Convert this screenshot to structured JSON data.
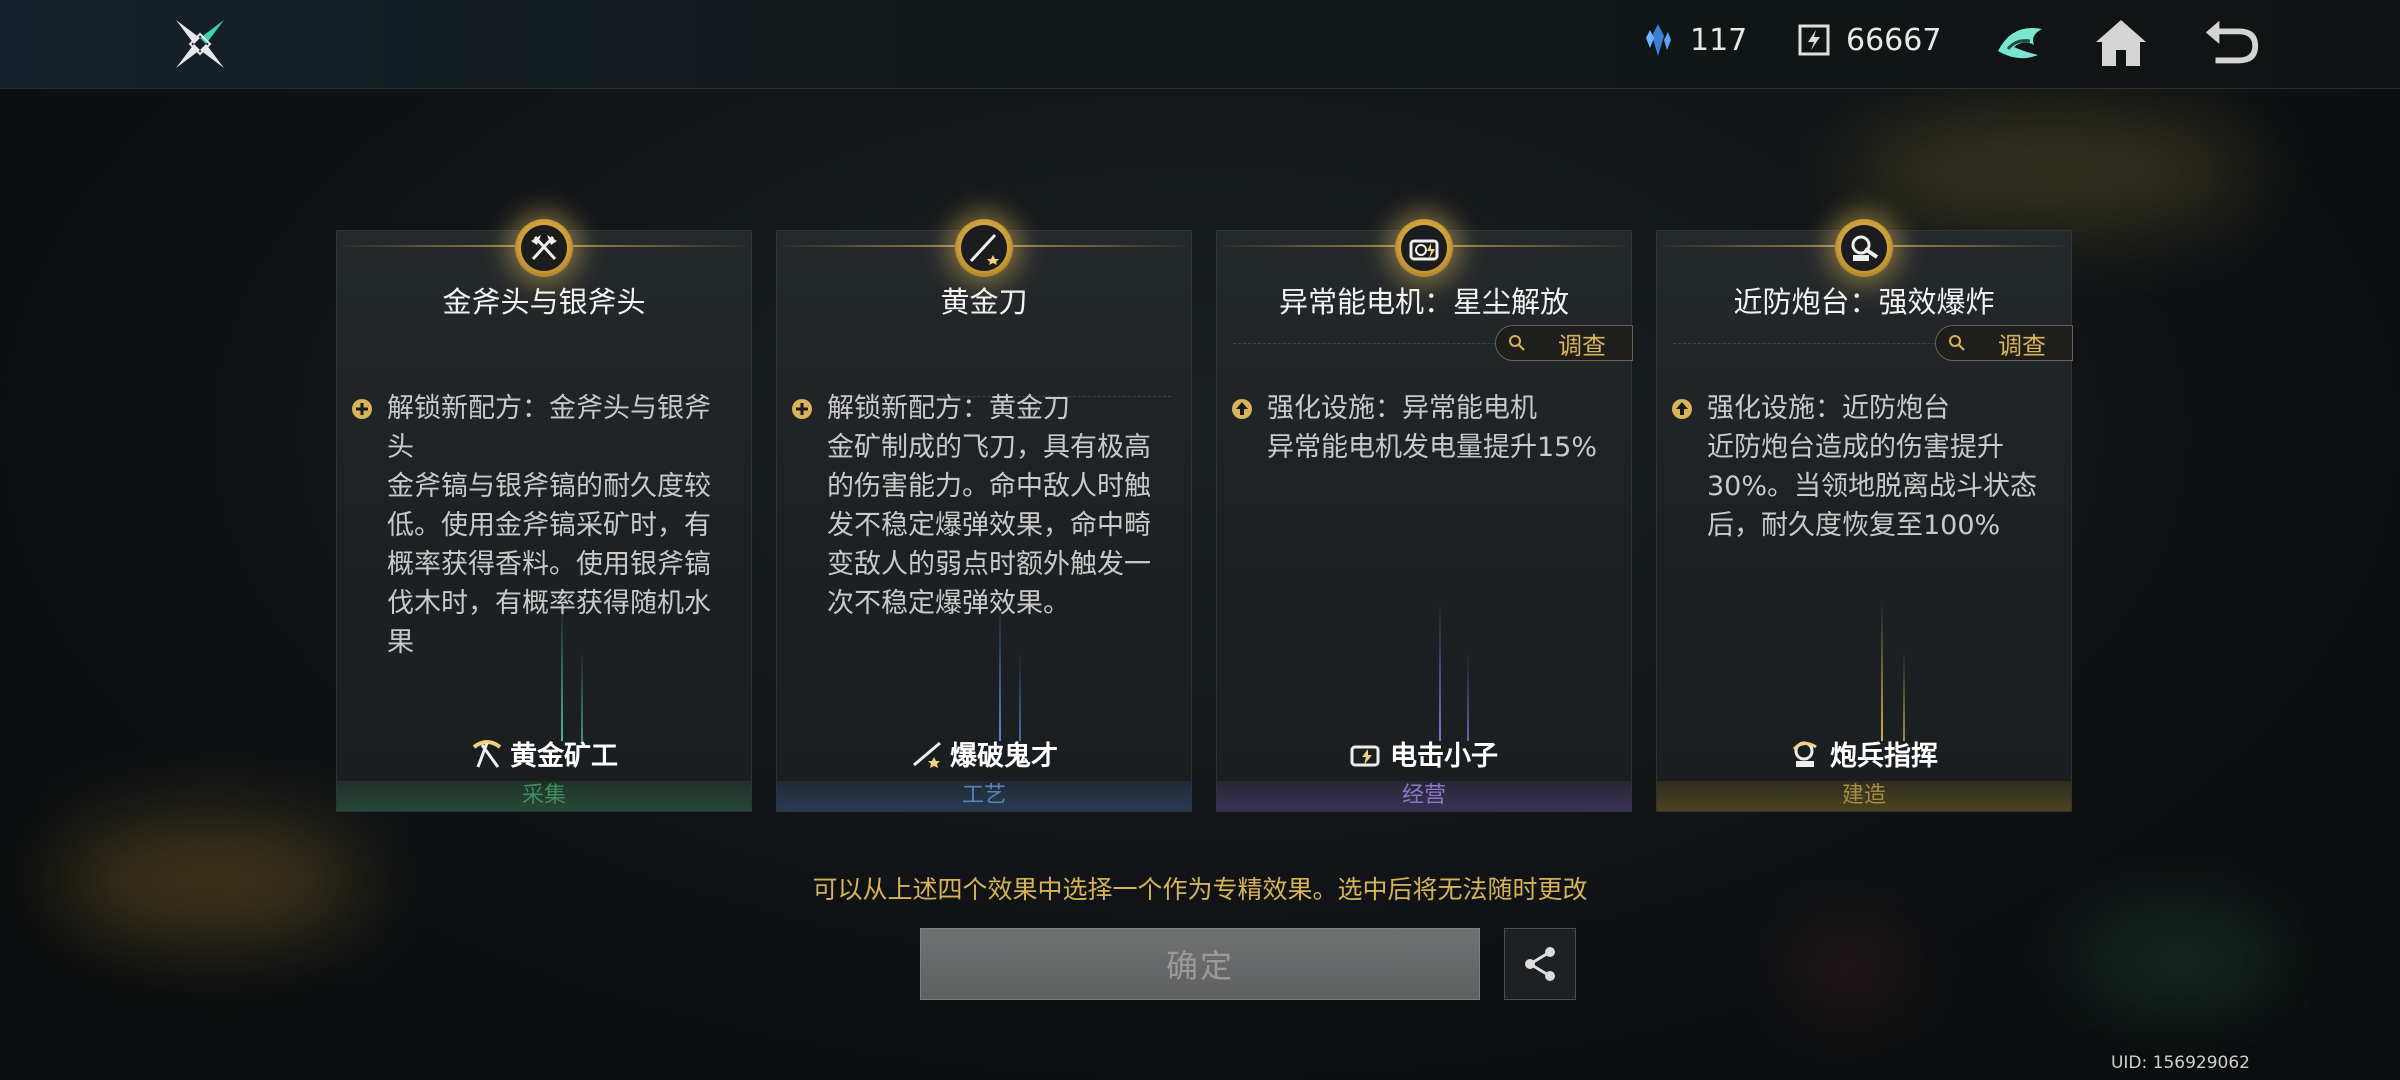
{
  "header": {
    "resource1_value": "117",
    "resource2_value": "66667",
    "resource1_icon": "crystal-icon",
    "resource2_icon": "coupon-icon"
  },
  "cards": [
    {
      "badge_icon": "crossed-axes-icon",
      "title": "金斧头与银斧头",
      "has_investigate": false,
      "effect_icon": "plus-icon",
      "effect_heading": "解锁新配方：金斧头与银斧头",
      "effect_body": "金斧镐与银斧镐的耐久度较低。使用金斧镐采矿时，有概率获得香料。使用银斧镐伐木时，有概率获得随机水果",
      "role_icon": "pickaxe-icon",
      "role": "黄金矿工",
      "category": "采集",
      "category_color": "#2f6a48"
    },
    {
      "badge_icon": "knife-icon",
      "title": "黄金刀",
      "has_investigate": false,
      "effect_icon": "plus-icon",
      "effect_heading": "解锁新配方：黄金刀",
      "effect_body": "金矿制成的飞刀，具有极高的伤害能力。命中敌人时触发不稳定爆弹效果，命中畸变敌人的弱点时额外触发一次不稳定爆弹效果。",
      "role_icon": "dagger-icon",
      "role": "爆破鬼才",
      "category": "工艺",
      "category_color": "#34507a"
    },
    {
      "badge_icon": "generator-icon",
      "title": "异常能电机：星尘解放",
      "has_investigate": true,
      "investigate_label": "调查",
      "effect_icon": "upgrade-icon",
      "effect_heading": "强化设施：异常能电机",
      "effect_body": "异常能电机发电量提升15%",
      "role_icon": "battery-icon",
      "role": "电击小子",
      "category": "经营",
      "category_color": "#4e3f7a"
    },
    {
      "badge_icon": "turret-icon",
      "title": "近防炮台：强效爆炸",
      "has_investigate": true,
      "investigate_label": "调查",
      "effect_icon": "upgrade-icon",
      "effect_heading": "强化设施：近防炮台",
      "effect_body": "近防炮台造成的伤害提升30%。当领地脱离战斗状态后，耐久度恢复至100%",
      "role_icon": "commander-icon",
      "role": "炮兵指挥",
      "category": "建造",
      "category_color": "#6b5b22"
    }
  ],
  "hint": "可以从上述四个效果中选择一个作为专精效果。选中后将无法随时更改",
  "confirm_label": "确定",
  "uid": "UID: 156929062"
}
